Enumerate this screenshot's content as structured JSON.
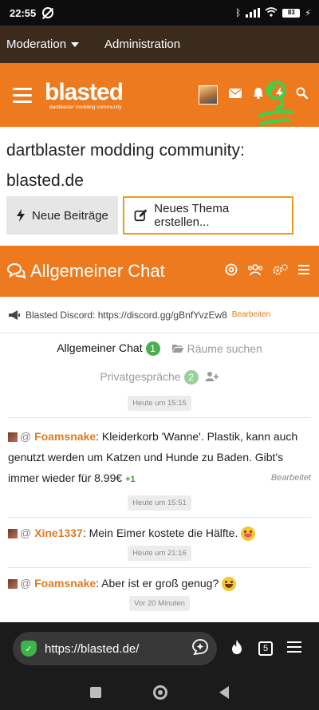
{
  "status_bar": {
    "time": "22:55",
    "battery": "83"
  },
  "admin_nav": {
    "moderation": "Moderation",
    "administration": "Administration"
  },
  "header": {
    "logo_word": "blasted",
    "logo_tagline": "dartblaster modding community"
  },
  "page": {
    "title": "dartblaster modding community: blasted.de",
    "new_posts_button": "Neue Beiträge",
    "new_thread_button": "Neues Thema erstellen..."
  },
  "chat": {
    "title": "Allgemeiner Chat",
    "announcement": "Blasted Discord: https://discord.gg/gBnfYvzEw8",
    "announcement_edit": "Bearbeiten",
    "tab_general": "Allgemeiner Chat",
    "tab_general_count": "1",
    "tab_rooms": "Räume suchen",
    "tab_private": "Privatgespräche",
    "tab_private_count": "2",
    "messages": [
      {
        "time_above": "Heute um 15:15"
      },
      {
        "user": "Foamsnake",
        "text": ": Kleiderkorb 'Wanne'. Plastik, kann auch genutzt werden um Katzen und Hunde zu Baden. Gibt's immer wieder für 8.99€",
        "likes": "+1",
        "edited": "Bearbeitet",
        "time": "Heute um 15:51"
      },
      {
        "user": "Xine1337",
        "text": ": Mein Eimer kostete die Hälfte.",
        "emoji": "squinting-tongue-emoji",
        "time": "Heute um 21:16"
      },
      {
        "user": "Foamsnake",
        "text": ": Aber ist er groß genug?",
        "emoji": "grinning-emoji",
        "time": "Vor 20 Minuten"
      }
    ]
  },
  "browser": {
    "url": "https://blasted.de/",
    "tab_count": "5"
  },
  "colors": {
    "orange": "#ee7a1f",
    "admin_bar": "#3b2b1c",
    "green": "#4fae4f",
    "highlight": "#ef9a1c"
  }
}
